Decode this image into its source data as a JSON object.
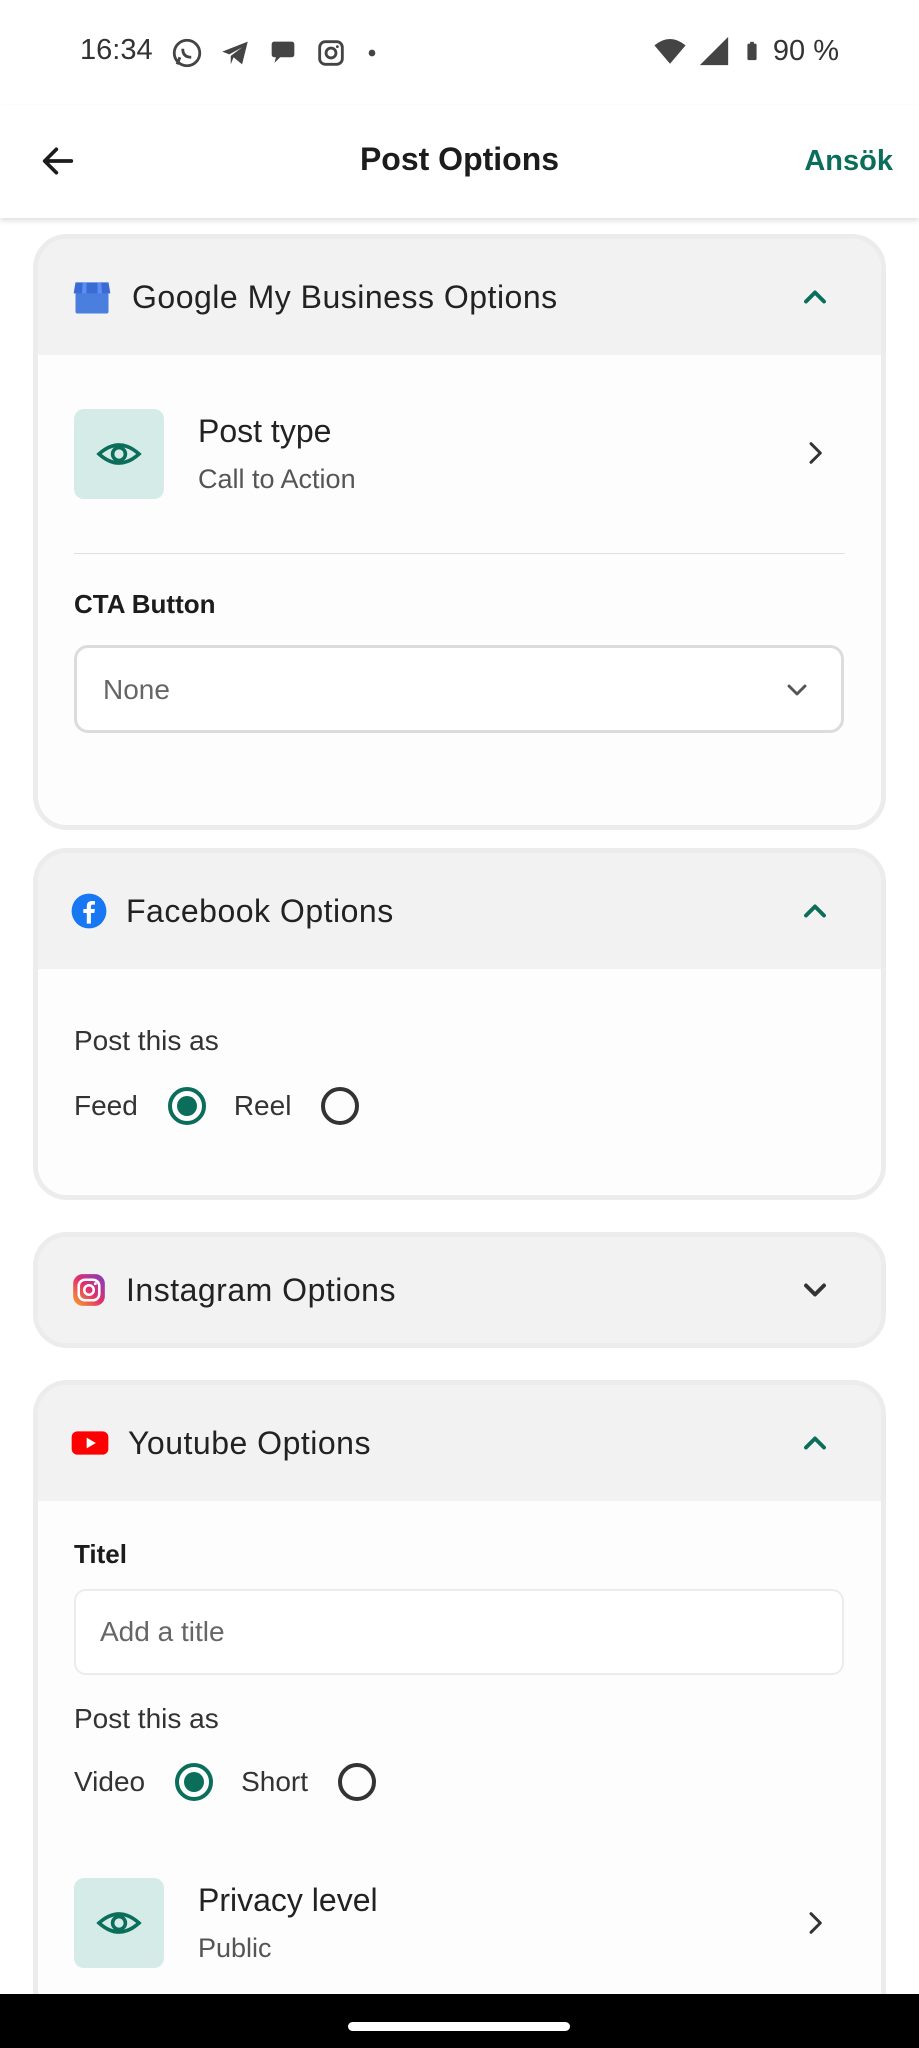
{
  "status_bar": {
    "time": "16:34",
    "battery": "90 %",
    "left_icons": [
      "whatsapp-icon",
      "telegram-icon",
      "chat-bubble-icon",
      "instagram-icon",
      "dot-icon"
    ],
    "right_icons": [
      "wifi-icon",
      "signal-icon",
      "battery-icon"
    ]
  },
  "app_bar": {
    "title": "Post Options",
    "apply_label": "Ansök",
    "accent_color": "#0b6e5a"
  },
  "gmb_card": {
    "title": "Google My Business Options",
    "expanded": true,
    "post_type": {
      "title": "Post type",
      "value": "Call to Action"
    },
    "cta_label": "CTA Button",
    "cta_selected": "None"
  },
  "facebook_card": {
    "title": "Facebook Options",
    "expanded": true,
    "post_as_label": "Post this as",
    "options": [
      {
        "label": "Feed",
        "checked": true
      },
      {
        "label": "Reel",
        "checked": false
      }
    ]
  },
  "instagram_card": {
    "title": "Instagram Options",
    "expanded": false
  },
  "youtube_card": {
    "title": "Youtube Options",
    "expanded": true,
    "title_label": "Titel",
    "title_placeholder": "Add a title",
    "post_as_label": "Post this as",
    "options": [
      {
        "label": "Video",
        "checked": true
      },
      {
        "label": "Short",
        "checked": false
      }
    ],
    "privacy": {
      "title": "Privacy level",
      "value": "Public"
    }
  }
}
